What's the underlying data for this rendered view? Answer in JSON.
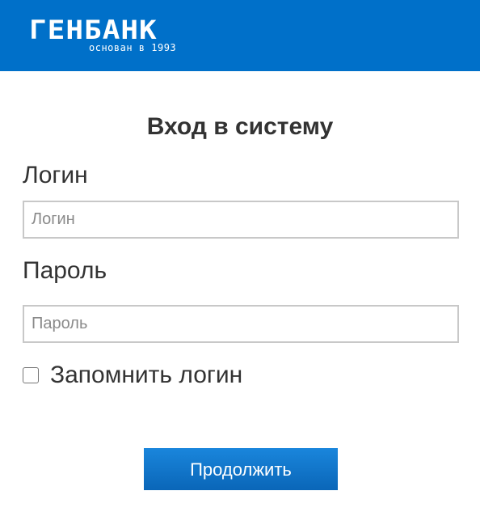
{
  "header": {
    "brand": "ГЕНБАНК",
    "tagline": "основан в 1993",
    "background": "#0070c9"
  },
  "form": {
    "title": "Вход в систему",
    "login": {
      "label": "Логин",
      "placeholder": "Логин",
      "value": ""
    },
    "password": {
      "label": "Пароль",
      "placeholder": "Пароль",
      "value": ""
    },
    "remember": {
      "label": "Запомнить логин",
      "checked": false
    },
    "submit_label": "Продолжить",
    "accent": "#0a70c7"
  }
}
